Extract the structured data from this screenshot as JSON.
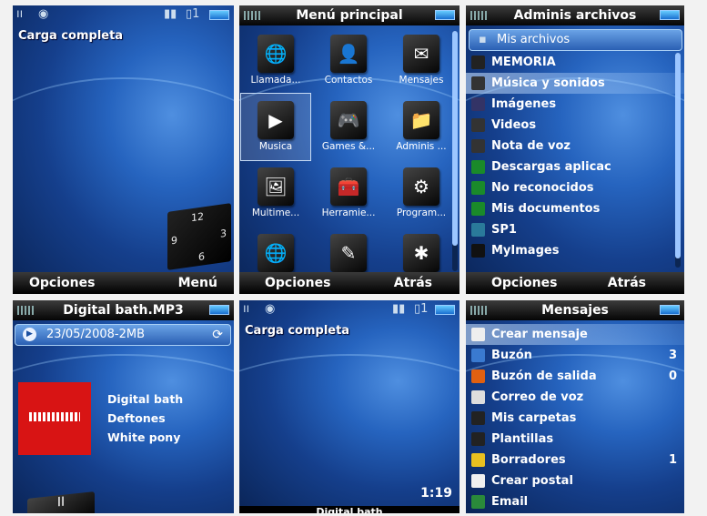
{
  "idle1": {
    "status": "Carga completa",
    "clock": [
      "12",
      "9",
      "3",
      "6"
    ],
    "soft_left": "Opciones",
    "soft_right": "Menú"
  },
  "menu": {
    "title": "Menú principal",
    "items": [
      {
        "label": "Llamada...",
        "icon": "globe-icon",
        "glyph": "🌐"
      },
      {
        "label": "Contactos",
        "icon": "contacts-icon",
        "glyph": "👤"
      },
      {
        "label": "Mensajes",
        "icon": "messages-icon",
        "glyph": "✉"
      },
      {
        "label": "Musica",
        "icon": "music-icon",
        "glyph": "▶"
      },
      {
        "label": "Games &...",
        "icon": "gamepad-icon",
        "glyph": "🎮"
      },
      {
        "label": "Adminis ...",
        "icon": "folder-icon",
        "glyph": "📁"
      },
      {
        "label": "Multime...",
        "icon": "multimedia-icon",
        "glyph": "🖼"
      },
      {
        "label": "Herramie...",
        "icon": "tools-icon",
        "glyph": "🧰"
      },
      {
        "label": "Program...",
        "icon": "gear-icon",
        "glyph": "⚙"
      },
      {
        "label": "",
        "icon": "web-icon",
        "glyph": "🌐"
      },
      {
        "label": "",
        "icon": "pen-icon",
        "glyph": "✎"
      },
      {
        "label": "",
        "icon": "bluetooth-icon",
        "glyph": "✱"
      }
    ],
    "soft_left": "Opciones",
    "soft_right": "Atrás"
  },
  "files": {
    "title": "Adminis archivos",
    "header": "Mis archivos",
    "items": [
      {
        "label": "MEMORIA",
        "icon": "memory-icon",
        "color": "#222"
      },
      {
        "label": "Música y sonidos",
        "icon": "music-note-icon",
        "color": "#333"
      },
      {
        "label": "Imágenes",
        "icon": "image-icon",
        "color": "#336"
      },
      {
        "label": "Videos",
        "icon": "video-icon",
        "color": "#333"
      },
      {
        "label": "Nota de voz",
        "icon": "voice-note-icon",
        "color": "#333"
      },
      {
        "label": "Descargas aplicac",
        "icon": "download-icon",
        "color": "#1a8a2a"
      },
      {
        "label": "No reconocidos",
        "icon": "unknown-icon",
        "color": "#1a8a2a"
      },
      {
        "label": "Mis documentos",
        "icon": "document-icon",
        "color": "#1a8a2a"
      },
      {
        "label": "SP1",
        "icon": "globe-icon",
        "color": "#2a7a9a"
      },
      {
        "label": "MyImages",
        "icon": "folder-icon",
        "color": "#111"
      }
    ],
    "soft_left": "Opciones",
    "soft_right": "Atrás"
  },
  "player": {
    "title": "Digital bath.MP3",
    "info": "23/05/2008-2MB",
    "track": "Digital bath",
    "artist": "Deftones",
    "album": "White pony",
    "pause": "II"
  },
  "idle2": {
    "status": "Carga completa",
    "time": "1:19",
    "now_playing": "Digital bath"
  },
  "messages": {
    "title": "Mensajes",
    "items": [
      {
        "label": "Crear mensaje",
        "count": "",
        "icon": "compose-icon",
        "color": "#eee"
      },
      {
        "label": "Buzón",
        "count": "3",
        "icon": "inbox-icon",
        "color": "#3a7ad0"
      },
      {
        "label": "Buzón de salida",
        "count": "0",
        "icon": "outbox-icon",
        "color": "#e06010"
      },
      {
        "label": "Correo de voz",
        "count": "",
        "icon": "voicemail-icon",
        "color": "#ddd"
      },
      {
        "label": "Mis carpetas",
        "count": "",
        "icon": "folders-icon",
        "color": "#222"
      },
      {
        "label": "Plantillas",
        "count": "",
        "icon": "templates-icon",
        "color": "#222"
      },
      {
        "label": "Borradores",
        "count": "1",
        "icon": "drafts-icon",
        "color": "#e8c020"
      },
      {
        "label": "Crear postal",
        "count": "",
        "icon": "postcard-icon",
        "color": "#f0f0f0"
      },
      {
        "label": "Email",
        "count": "",
        "icon": "email-icon",
        "color": "#2a8a3a"
      }
    ]
  }
}
